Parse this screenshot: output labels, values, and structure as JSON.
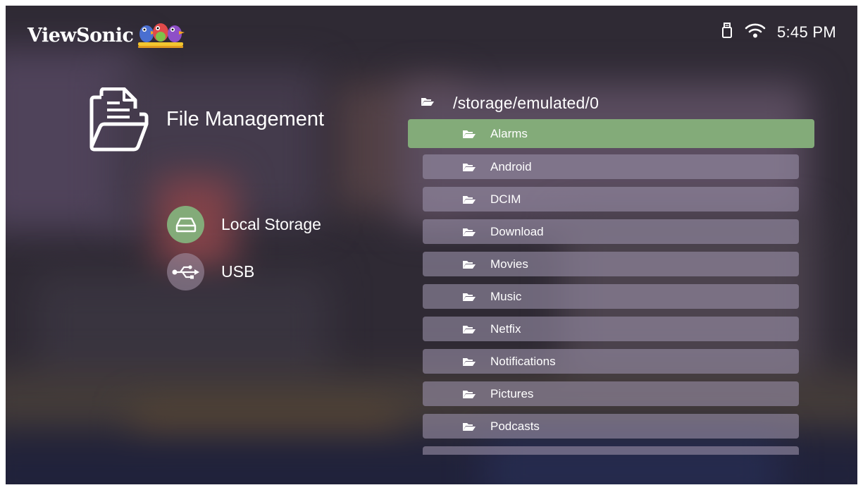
{
  "brand": {
    "name": "ViewSonic",
    "logo_icon": "three-birds-logo"
  },
  "status_bar": {
    "usb_icon": "usb-drive-icon",
    "wifi_icon": "wifi-icon",
    "time": "5:45 PM"
  },
  "panel": {
    "title": "File Management",
    "icon": "folder-document-icon"
  },
  "sources": [
    {
      "label": "Local Storage",
      "icon": "hard-drive-icon",
      "selected": true
    },
    {
      "label": "USB",
      "icon": "usb-symbol-icon",
      "selected": false
    }
  ],
  "file_browser": {
    "path": "/storage/emulated/0",
    "folders": [
      {
        "name": "Alarms",
        "selected": true
      },
      {
        "name": "Android",
        "selected": false
      },
      {
        "name": "DCIM",
        "selected": false
      },
      {
        "name": "Download",
        "selected": false
      },
      {
        "name": "Movies",
        "selected": false
      },
      {
        "name": "Music",
        "selected": false
      },
      {
        "name": "Netfix",
        "selected": false
      },
      {
        "name": "Notifications",
        "selected": false
      },
      {
        "name": "Pictures",
        "selected": false
      },
      {
        "name": "Podcasts",
        "selected": false
      },
      {
        "name": "",
        "selected": false
      }
    ]
  },
  "colors": {
    "accent_green": "#83ab79",
    "row_background": "#968ca5",
    "text": "#ffffff"
  }
}
